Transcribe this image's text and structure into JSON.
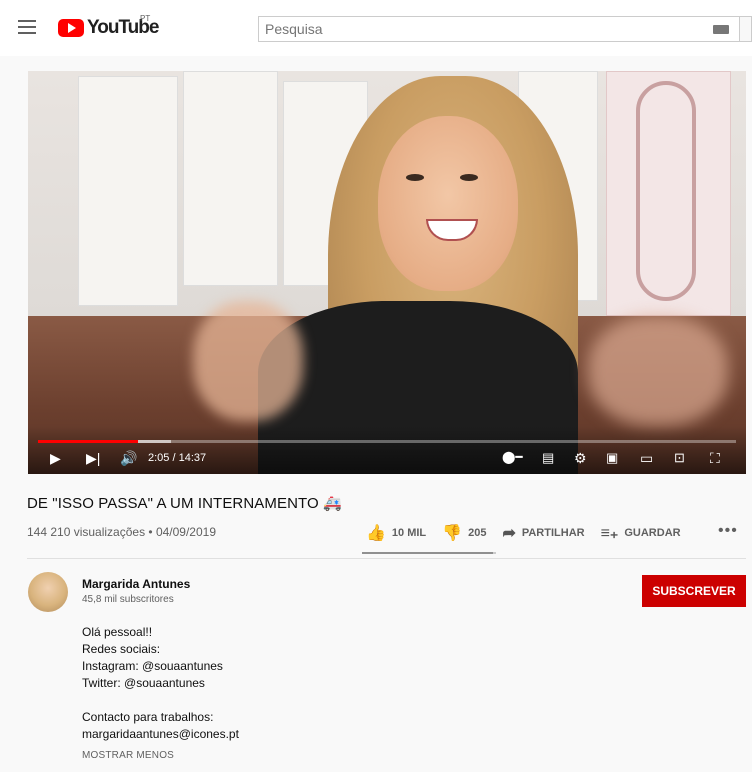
{
  "header": {
    "logo_text": "YouTube",
    "country": "PT",
    "search_placeholder": "Pesquisa"
  },
  "player": {
    "time": "2:05 / 14:37",
    "progress": 0.143,
    "buffered": 0.19
  },
  "video": {
    "title": "DE \"ISSO PASSA\" A UM INTERNAMENTO 🚑",
    "meta": "144 210 visualizações • 04/09/2019",
    "likes": "10 MIL",
    "dislikes": "205",
    "share_label": "PARTILHAR",
    "save_label": "GUARDAR",
    "like_ratio": 0.98
  },
  "channel": {
    "name": "Margarida Antunes",
    "subscribers": "45,8 mil subscritores",
    "subscribe_label": "SUBSCREVER"
  },
  "description": {
    "lines": [
      "Olá pessoal!!",
      "Redes sociais:",
      "Instagram: @souaantunes",
      "Twitter: @souaantunes",
      "",
      "Contacto para trabalhos:",
      "margaridaantunes@icones.pt"
    ],
    "show_less": "MOSTRAR MENOS"
  },
  "colors": {
    "brand": "#ff0000",
    "subscribe": "#cc0000"
  }
}
